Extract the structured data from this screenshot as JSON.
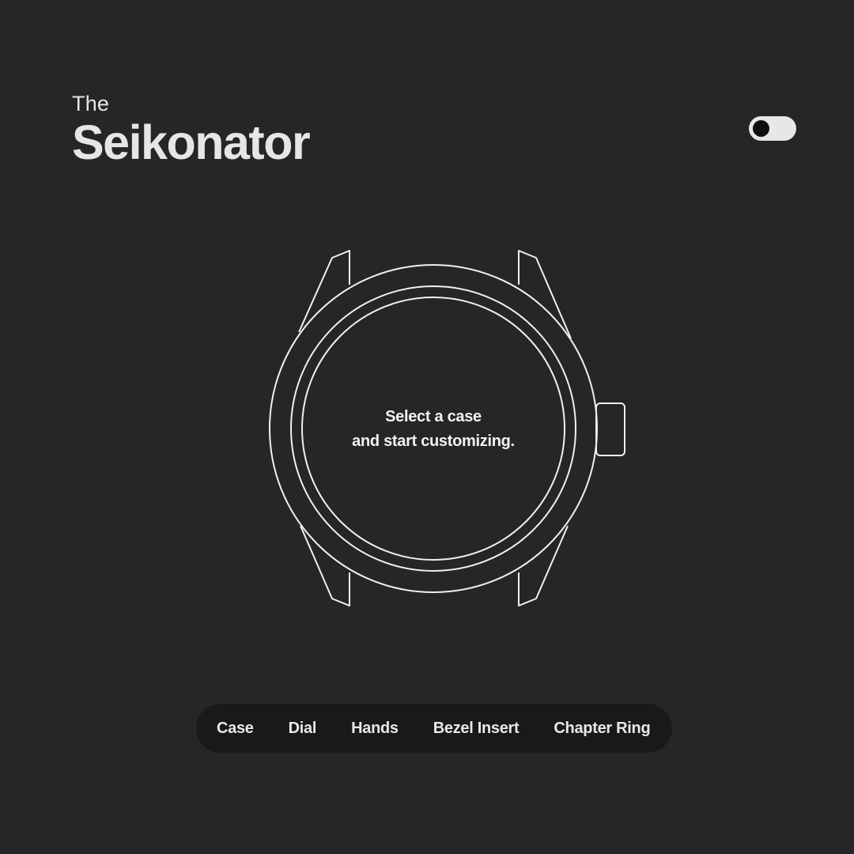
{
  "header": {
    "title_small": "The",
    "title_large": "Seikonator"
  },
  "theme_toggle": {
    "state": "dark"
  },
  "watch": {
    "prompt_line1": "Select a case",
    "prompt_line2": "and start customizing."
  },
  "tabs": [
    {
      "label": "Case"
    },
    {
      "label": "Dial"
    },
    {
      "label": "Hands"
    },
    {
      "label": "Bezel Insert"
    },
    {
      "label": "Chapter Ring"
    }
  ],
  "colors": {
    "background": "#262628",
    "tabbar_background": "#19191a",
    "text": "#e9e9ea",
    "outline": "#f0f0f0"
  }
}
